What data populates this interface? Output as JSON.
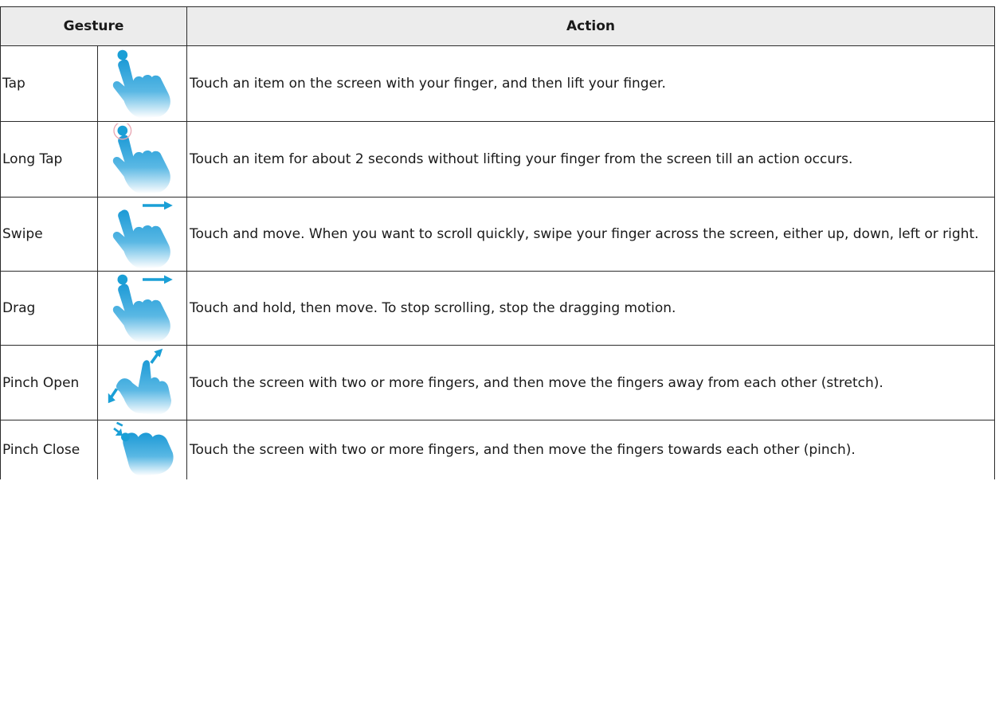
{
  "table": {
    "header_gesture": "Gesture",
    "header_action": "Action",
    "rows": [
      {
        "name": "Tap",
        "action": "Touch an item on the screen with your finger, and then lift your finger.",
        "icon": "tap-gesture-icon"
      },
      {
        "name": "Long Tap",
        "action": "Touch an item for about 2 seconds without lifting your finger from the screen till an action occurs.",
        "icon": "long-tap-gesture-icon"
      },
      {
        "name": "Swipe",
        "action": "Touch and move. When you want to scroll quickly, swipe your finger across the screen, either up, down, left or right.",
        "icon": "swipe-gesture-icon"
      },
      {
        "name": "Drag",
        "action": "Touch and hold, then move. To stop scrolling, stop the dragging motion.",
        "icon": "drag-gesture-icon"
      },
      {
        "name": "Pinch Open",
        "action": "Touch the screen with two or more fingers, and then move the fingers away from each other (stretch).",
        "icon": "pinch-open-gesture-icon"
      },
      {
        "name": "Pinch Close",
        "action": "Touch the screen with two or more fingers, and then move the fingers towards each other (pinch).",
        "icon": "pinch-close-gesture-icon"
      }
    ]
  },
  "colors": {
    "hand_top": "#2ea3d8",
    "hand_bottom": "#ffffff",
    "arrow": "#1a9fd6",
    "header_bg": "#ececec"
  }
}
